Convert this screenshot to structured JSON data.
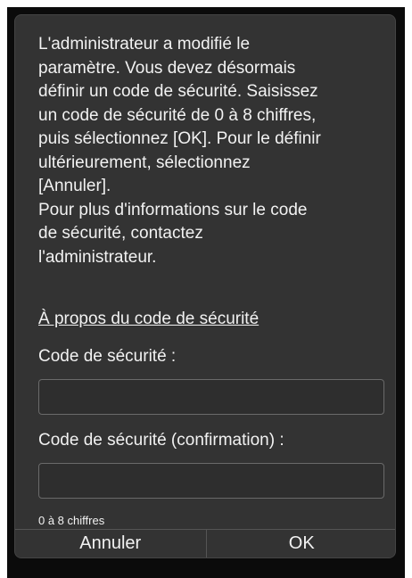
{
  "dialog": {
    "message": "L'administrateur a modifié le\nparamètre. Vous devez désormais\ndéfinir un code de sécurité. Saisissez\nun code de sécurité de 0 à 8 chiffres,\npuis sélectionnez [OK]. Pour le définir\nultérieurement, sélectionnez\n[Annuler].\nPour plus d'informations sur le code\nde sécurité, contactez\nl'administrateur.",
    "about_link": "À propos du code de sécurité",
    "code_label": "Code de sécurité :",
    "code_value": "",
    "confirm_label": "Code de sécurité (confirmation) :",
    "confirm_value": "",
    "hint": "0 à 8 chiffres",
    "cancel_label": "Annuler",
    "ok_label": "OK"
  },
  "colors": {
    "dialog_background": "#333333",
    "frame_background": "#0b0b0b",
    "text": "#f2f2f2"
  }
}
